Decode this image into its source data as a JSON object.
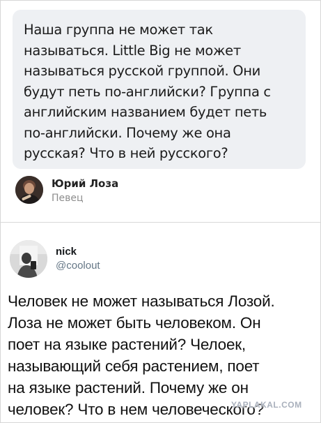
{
  "quote_post": {
    "text_lines": [
      "Наша группа не может так",
      "называться. Little Big не может",
      "называться русской группой. Они",
      "будут петь по-английски? Группа с",
      "английским названием будет петь",
      "по-английски. Почему же она",
      "русская? Что в ней русского?"
    ],
    "author_name": "Юрий Лоза",
    "author_role": "Певец"
  },
  "tweet": {
    "user_name": "nick",
    "user_handle": "@coolout",
    "text_lines": [
      "Человек не может называться Лозой.",
      "Лоза не может быть человеком. Он",
      "поет на языке растений? Челоек,",
      "называющий себя растением, поет",
      "на языке растений. Почему же он",
      "человек? Что в нем человеческого?"
    ]
  },
  "watermark": "YAPLAKAL.COM"
}
